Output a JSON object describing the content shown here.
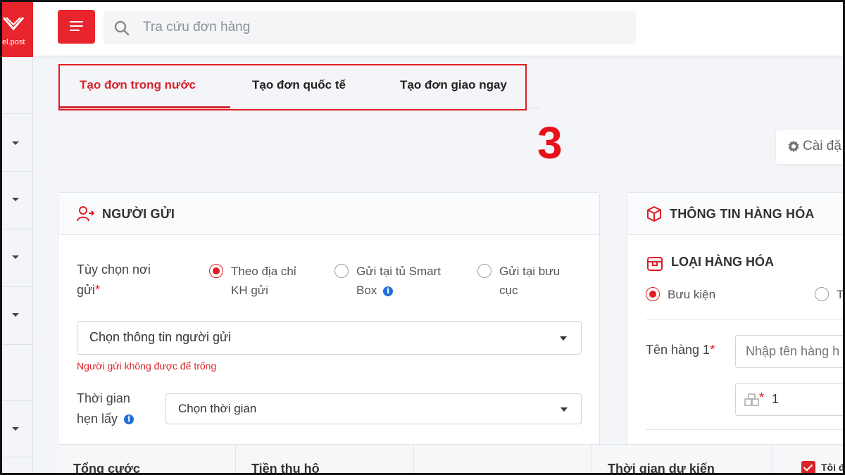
{
  "brand": {
    "logo_text": "el.post",
    "accent": "#e8242c"
  },
  "search": {
    "placeholder": "Tra cứu đơn hàng",
    "icon": "search-icon"
  },
  "tabs": [
    {
      "label": "Tạo đơn trong nước",
      "active": true
    },
    {
      "label": "Tạo đơn quốc tế",
      "active": false
    },
    {
      "label": "Tạo đơn giao ngay",
      "active": false
    }
  ],
  "annotation": {
    "step_number": "3",
    "color": "#e8101a"
  },
  "settings": {
    "label": "Cài đặ"
  },
  "sender": {
    "title": "NGƯỜI GỬI",
    "send_option": {
      "label_line1": "Tùy chọn nơi",
      "label_line2": "gửi",
      "required_mark": "*",
      "options": [
        {
          "line1": "Theo địa chỉ",
          "line2": "KH gửi",
          "checked": true
        },
        {
          "line1": "Gửi tại tủ Smart",
          "line2": "Box",
          "checked": false,
          "info_icon": true
        },
        {
          "line1": "Gửi tại bưu",
          "line2": "cục",
          "checked": false
        }
      ]
    },
    "sender_select": {
      "value": "Chọn thông tin người gửi"
    },
    "error": "Người gửi không được để trống",
    "pickup_time": {
      "label_line1": "Thời gian",
      "label_line2": "hẹn lấy",
      "value": "Chọn thời gian"
    }
  },
  "goods": {
    "title": "THÔNG TIN HÀNG HÓA",
    "type_title": "LOẠI HÀNG HÓA",
    "types": [
      {
        "label": "Bưu kiện",
        "checked": true
      },
      {
        "label": "T",
        "checked": false
      }
    ],
    "item_name_label": "Tên hàng 1",
    "required_mark": "*",
    "item_name_placeholder": "Nhập tên hàng h",
    "quantity_required": "*",
    "quantity": "1"
  },
  "summary": {
    "total_fee": "Tổng cước",
    "cod": "Tiền thu hộ",
    "expected_time": "Thời gian dự kiến",
    "checkbox_label": "Tôi đ"
  }
}
